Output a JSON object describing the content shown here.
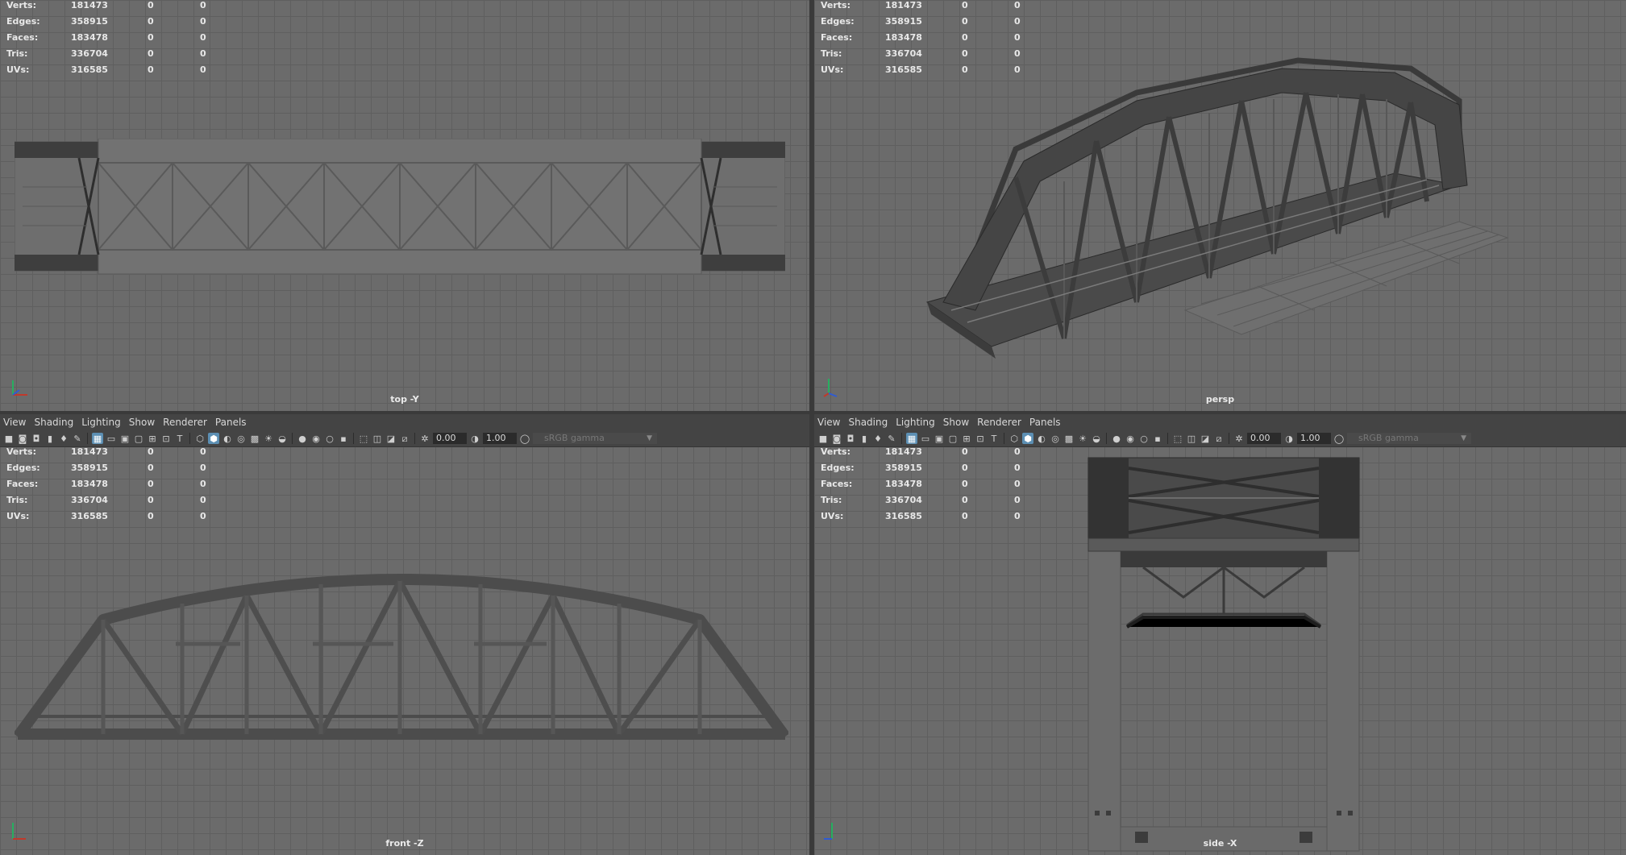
{
  "stats": {
    "labels": [
      "Verts:",
      "Edges:",
      "Faces:",
      "Tris:",
      "UVs:"
    ],
    "values": [
      "181473",
      "358915",
      "183478",
      "336704",
      "316585"
    ],
    "zeros": [
      "0",
      "0"
    ]
  },
  "menu": [
    "View",
    "Shading",
    "Lighting",
    "Show",
    "Renderer",
    "Panels"
  ],
  "toolbar": {
    "exposure": "0.00",
    "gamma_value": "1.00",
    "color_space": "sRGB gamma"
  },
  "views": {
    "top": "top -Y",
    "persp": "persp",
    "front": "front -Z",
    "side": "side -X"
  },
  "axes": {
    "x": "#c0392b",
    "y": "#27ae60",
    "z": "#2f5bd3"
  }
}
